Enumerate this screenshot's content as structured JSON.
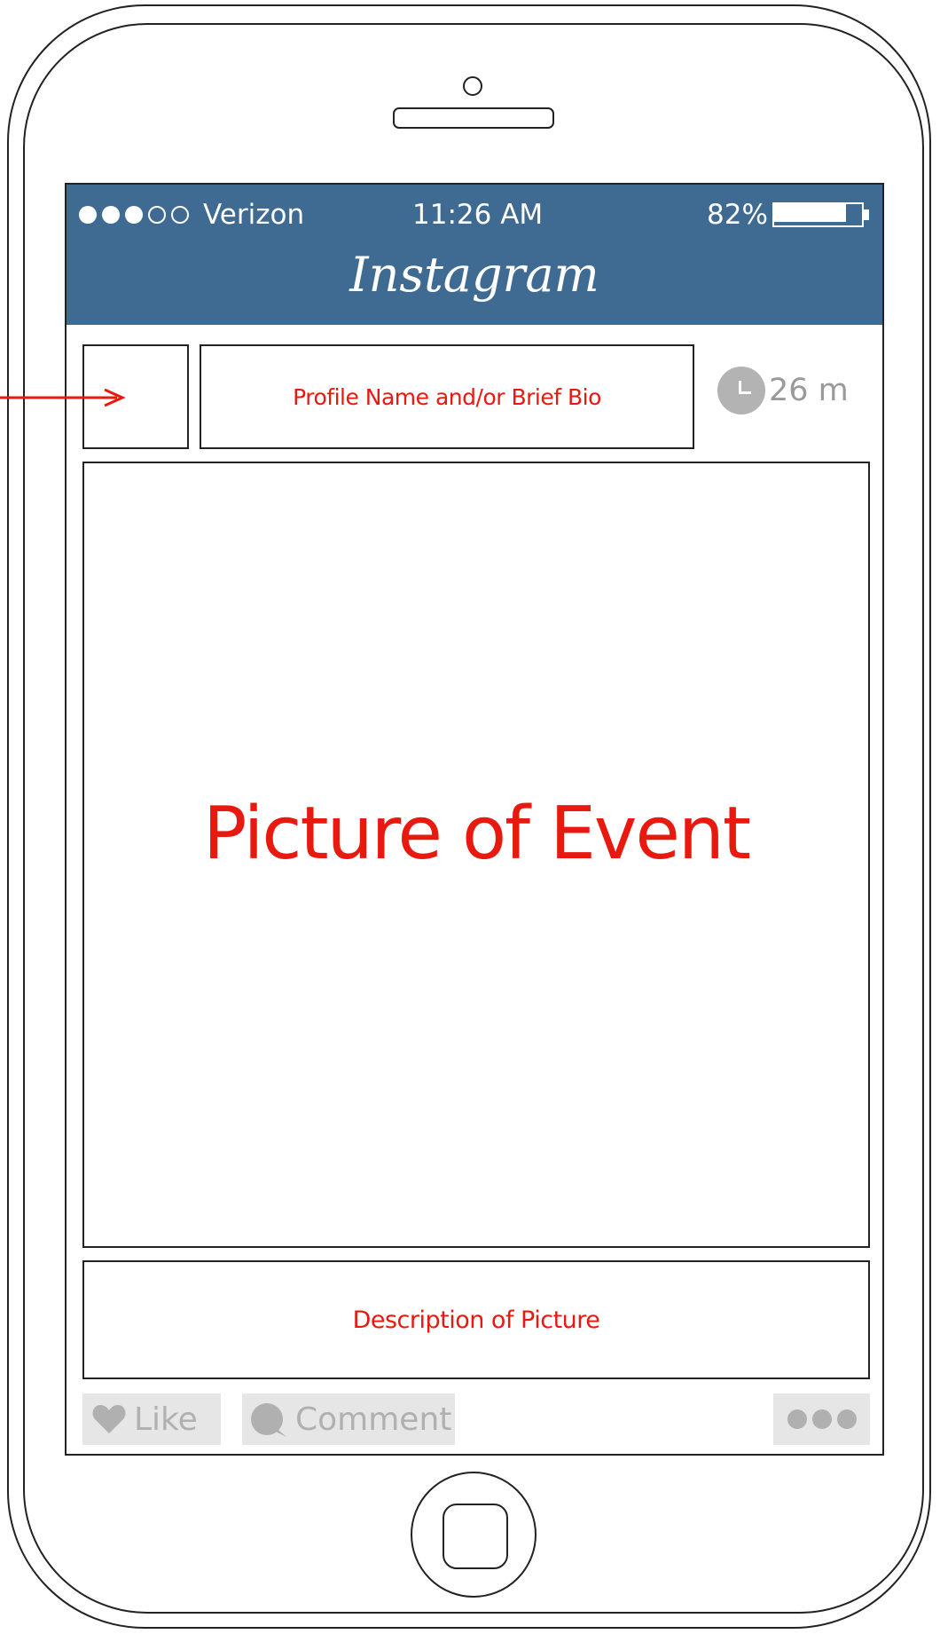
{
  "status_bar": {
    "signal_dots_filled": 3,
    "signal_dots_empty": 2,
    "carrier": "Verizon",
    "time": "11:26 AM",
    "battery_percent": "82%",
    "battery_level": 0.82
  },
  "header": {
    "app_title": "Instagram"
  },
  "post": {
    "profile_text": "Profile Name and/or Brief Bio",
    "time_ago": "26 m",
    "picture_text": "Picture of Event",
    "description_text": "Description of Picture"
  },
  "actions": {
    "like_label": "Like",
    "comment_label": "Comment",
    "more_icon": "ellipsis-icon"
  },
  "colors": {
    "header_bg": "#3f6b92",
    "annotation_red": "#e8190f",
    "action_gray": "#b0b0b0"
  }
}
